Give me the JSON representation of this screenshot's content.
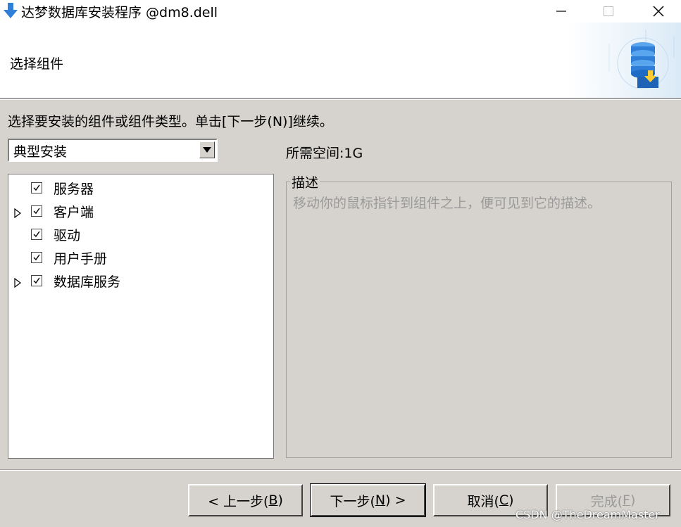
{
  "window": {
    "title": "达梦数据库安装程序 @dm8.dell",
    "controls": {
      "minimize": "—",
      "maximize": "☐",
      "close": "✕"
    }
  },
  "header": {
    "title": "选择组件"
  },
  "instruction": "选择要安装的组件或组件类型。单击[下一步(N)]继续。",
  "install_type": {
    "selected": "典型安装"
  },
  "required_space": "所需空间:1G",
  "components": [
    {
      "label": "服务器",
      "checked": true,
      "expandable": false
    },
    {
      "label": "客户端",
      "checked": true,
      "expandable": true
    },
    {
      "label": "驱动",
      "checked": true,
      "expandable": false
    },
    {
      "label": "用户手册",
      "checked": true,
      "expandable": false
    },
    {
      "label": "数据库服务",
      "checked": true,
      "expandable": true
    }
  ],
  "description": {
    "legend": "描述",
    "text": "移动你的鼠标指针到组件之上，便可见到它的描述。"
  },
  "buttons": {
    "back": {
      "label_pre": "< 上一步(",
      "key": "B",
      "label_post": ")"
    },
    "next": {
      "label_pre": "下一步(",
      "key": "N",
      "label_post": ") >"
    },
    "cancel": {
      "label_pre": "取消(",
      "key": "C",
      "label_post": ")"
    },
    "finish": {
      "label_pre": "完成(",
      "key": "F",
      "label_post": ")"
    }
  },
  "watermark": "CSDN @TheDreamMaster",
  "colors": {
    "dialog_bg": "#d6d3ce",
    "icon_blue": "#2f7fd8",
    "disabled_text": "#9a9a9a"
  }
}
